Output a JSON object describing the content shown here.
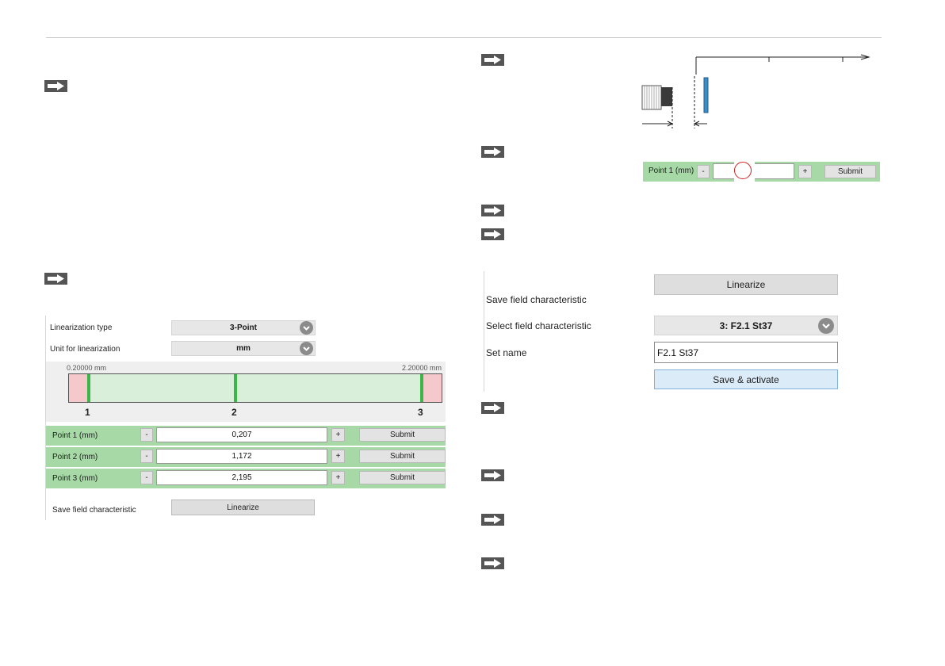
{
  "linearization_panel": {
    "type_label": "Linearization type",
    "type_value": "3-Point",
    "unit_label": "Unit for linearization",
    "unit_value": "mm",
    "range_min": "0.20000 mm",
    "range_max": "2.20000 mm",
    "marker_labels": [
      "1",
      "2",
      "3"
    ],
    "points": [
      {
        "label": "Point 1 (mm)",
        "value": "0,207"
      },
      {
        "label": "Point 2 (mm)",
        "value": "1,172"
      },
      {
        "label": "Point 3 (mm)",
        "value": "2,195"
      }
    ],
    "minus_label": "-",
    "plus_label": "+",
    "submit_label": "Submit",
    "save_label": "Save field characteristic",
    "linearize_label": "Linearize"
  },
  "point_detail": {
    "label": "Point 1 (mm)",
    "minus_label": "-",
    "plus_label": "+",
    "submit_label": "Submit"
  },
  "save_panel": {
    "linearize_label": "Linearize",
    "save_label": "Save field characteristic",
    "select_label": "Select field characteristic",
    "select_value": "3: F2.1 St37",
    "name_label": "Set name",
    "name_value": "F2.1 St37",
    "save_activate_label": "Save & activate"
  },
  "colors": {
    "green_row": "#a6d9a6",
    "light_green": "#d9efd9",
    "marker_green": "#3cb54a",
    "pink_end": "#f5c9cc",
    "target_blue": "#3a8dc8",
    "active_button": "#dcebf8"
  }
}
